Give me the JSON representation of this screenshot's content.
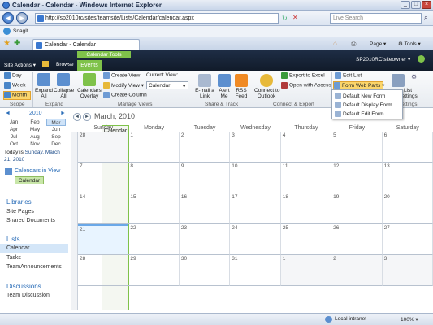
{
  "window": {
    "title": "Calendar - Calendar - Windows Internet Explorer"
  },
  "browser": {
    "url": "http://sp2010rc/sites/teamsite/Lists/Calendar/calendar.aspx",
    "search_placeholder": "Live Search",
    "favorites": [
      "SnagIt"
    ],
    "tab_title": "Calendar - Calendar",
    "toolbar": {
      "page": "Page",
      "tools": "Tools"
    }
  },
  "sharepoint": {
    "site_actions": "Site Actions",
    "browse": "Browse",
    "context_label": "Calendar Tools",
    "tabs": [
      "Events",
      "Calendar"
    ],
    "user": "SP2010RC\\siteowner"
  },
  "ribbon": {
    "scope": {
      "day": "Day",
      "week": "Week",
      "month": "Month",
      "label": "Scope"
    },
    "expand": {
      "expand_all": [
        "Expand",
        "All"
      ],
      "collapse_all": [
        "Collapse",
        "All"
      ],
      "label": "Expand"
    },
    "manage_views": {
      "overlay": [
        "Calendars",
        "Overlay"
      ],
      "create_view": "Create View",
      "modify_view": "Modify View",
      "create_column": "Create Column",
      "current_view_label": "Current View:",
      "current_view_value": "Calendar",
      "label": "Manage Views"
    },
    "share_track": {
      "email": [
        "E-mail a",
        "Link"
      ],
      "alert": [
        "Alert",
        "Me"
      ],
      "rss": [
        "RSS",
        "Feed"
      ],
      "label": "Share & Track"
    },
    "connect_export": {
      "outlook": [
        "Connect to",
        "Outlook"
      ],
      "excel": "Export to Excel",
      "access": "Open with Access",
      "label": "Connect & Export"
    },
    "customize": {
      "edit_list": "Edit List",
      "form_web_parts": "Form Web Parts",
      "settings_partial": [
        "List",
        "Settings"
      ],
      "label": "Settings"
    },
    "dropdown": [
      "Default New Form",
      "Default Display Form",
      "Default Edit Form"
    ]
  },
  "datepicker": {
    "year": "2010",
    "months": [
      "Jan",
      "Feb",
      "Mar",
      "Apr",
      "May",
      "Jun",
      "Jul",
      "Aug",
      "Sep",
      "Oct",
      "Nov",
      "Dec"
    ],
    "selected_month": "Mar",
    "today_label": "Today is",
    "today_link": "Sunday, March 21, 2010"
  },
  "left_nav": {
    "calendars_in_view": "Calendars in View",
    "calendar_chip": "Calendar",
    "libraries": "Libraries",
    "library_items": [
      "Site Pages",
      "Shared Documents"
    ],
    "lists": "Lists",
    "list_items": [
      "Calendar",
      "Tasks",
      "TeamAnnouncements"
    ],
    "discussions": "Discussions",
    "discussion_items": [
      "Team Discussion"
    ]
  },
  "calendar": {
    "title": "March, 2010",
    "weekdays": [
      "Sunday",
      "Monday",
      "Tuesday",
      "Wednesday",
      "Thursday",
      "Friday",
      "Saturday"
    ],
    "weeks": [
      [
        "28",
        "1",
        "2",
        "3",
        "4",
        "5",
        "6"
      ],
      [
        "7",
        "8",
        "9",
        "10",
        "11",
        "12",
        "13"
      ],
      [
        "14",
        "15",
        "16",
        "17",
        "18",
        "19",
        "20"
      ],
      [
        "21",
        "22",
        "23",
        "24",
        "25",
        "26",
        "27"
      ],
      [
        "28",
        "29",
        "30",
        "31",
        "1",
        "2",
        "3"
      ]
    ]
  },
  "status": {
    "zone": "Local intranet",
    "zoom": "100%"
  }
}
